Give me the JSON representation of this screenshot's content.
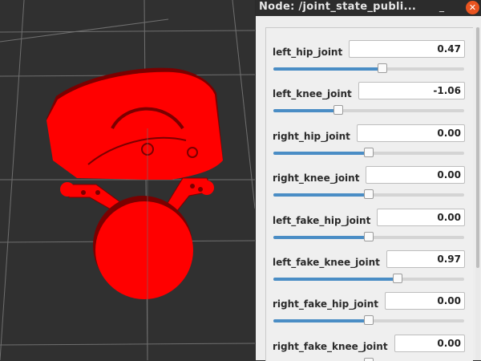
{
  "window": {
    "title": "Node: /joint_state_publi...",
    "minimize_glyph": "_",
    "close_glyph": "✕"
  },
  "viewport": {
    "background_color": "#303030",
    "robot_color": "#ff0000"
  },
  "joints": [
    {
      "name": "left_hip_joint",
      "value": "0.47",
      "level": 0.57
    },
    {
      "name": "left_knee_joint",
      "value": "-1.06",
      "level": 0.34
    },
    {
      "name": "right_hip_joint",
      "value": "0.00",
      "level": 0.5
    },
    {
      "name": "right_knee_joint",
      "value": "0.00",
      "level": 0.5
    },
    {
      "name": "left_fake_hip_joint",
      "value": "0.00",
      "level": 0.5
    },
    {
      "name": "left_fake_knee_joint",
      "value": "0.97",
      "level": 0.65
    },
    {
      "name": "right_fake_hip_joint",
      "value": "0.00",
      "level": 0.5
    },
    {
      "name": "right_fake_knee_joint",
      "value": "0.00",
      "level": 0.5
    }
  ]
}
